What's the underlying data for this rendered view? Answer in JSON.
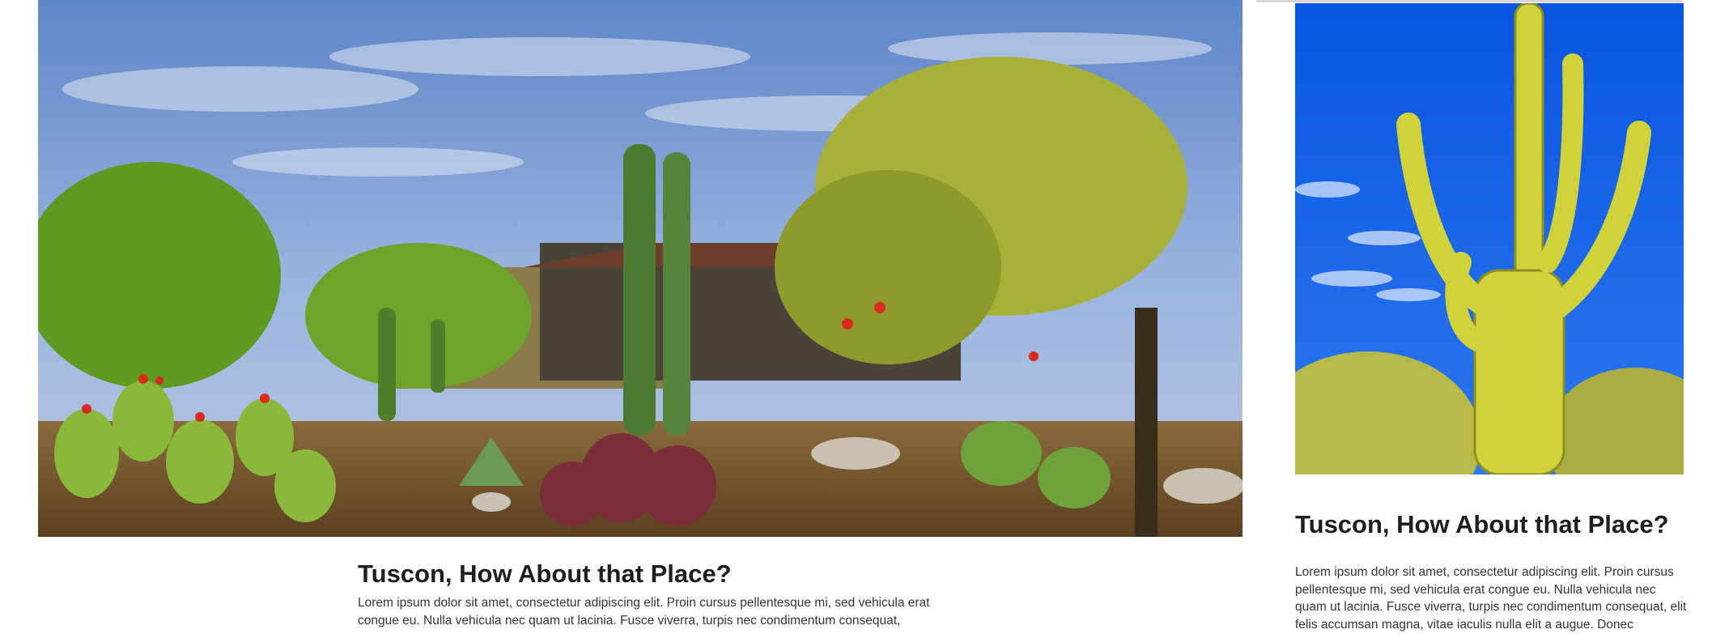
{
  "left_article": {
    "image_alt": "Desert garden with saguaro, cholla and prickly pear cactus",
    "title": "Tuscon, How About that Place?",
    "body": "Lorem ipsum dolor sit amet, consectetur adipiscing elit. Proin cursus pellentesque mi, sed vehicula erat congue eu. Nulla vehicula nec quam ut lacinia. Fusce viverra, turpis nec condimentum consequat,"
  },
  "right_article": {
    "image_alt": "Saguaro cactus against blue sky",
    "title": "Tuscon, How About that Place?",
    "body": "Lorem ipsum dolor sit amet, consectetur adipiscing elit. Proin cursus pellentesque mi, sed vehicula erat congue eu. Nulla vehicula nec quam ut lacinia. Fusce viverra, turpis nec condimentum consequat, elit felis accumsan magna, vitae iaculis nulla elit a augue. Donec"
  },
  "colors": {
    "sky_left": "#7a9fd8",
    "sky_right": "#1463ea",
    "cactus_green": "#4f7d2a",
    "saguaro_yellow": "#c9c935",
    "heading": "#1e1e1e",
    "body_text": "#333333"
  }
}
